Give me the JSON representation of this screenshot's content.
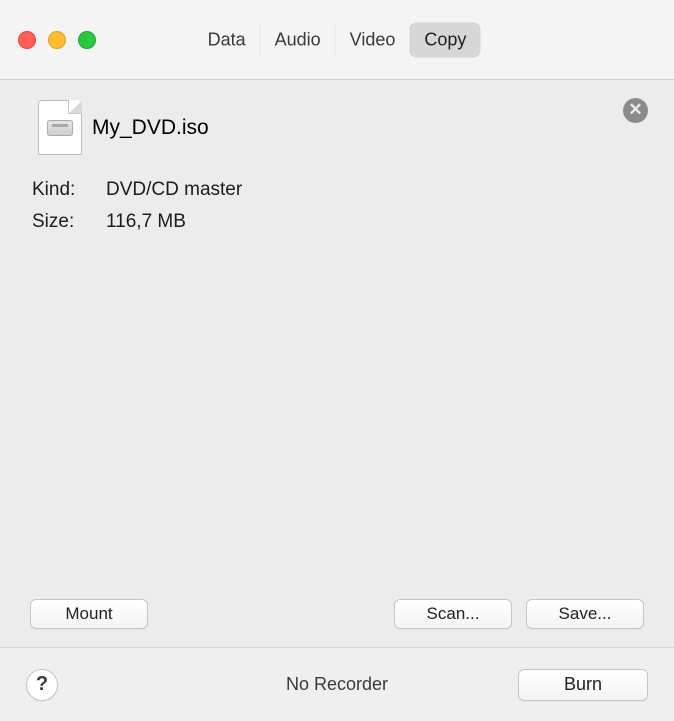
{
  "tabs": {
    "data": "Data",
    "audio": "Audio",
    "video": "Video",
    "copy": "Copy",
    "active": "copy"
  },
  "file": {
    "name": "My_DVD.iso"
  },
  "info": {
    "kind_label": "Kind:",
    "kind_value": "DVD/CD master",
    "size_label": "Size:",
    "size_value": "116,7 MB"
  },
  "buttons": {
    "mount": "Mount",
    "scan": "Scan...",
    "save": "Save...",
    "burn": "Burn"
  },
  "status": {
    "text": "No Recorder"
  },
  "help_glyph": "?"
}
